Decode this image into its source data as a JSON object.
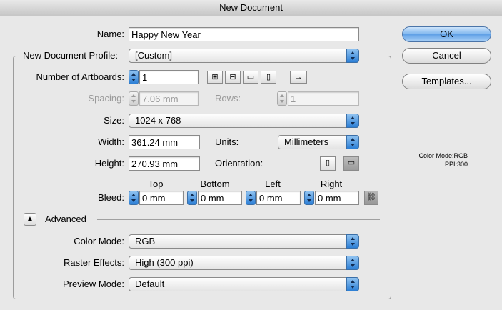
{
  "window": {
    "title": "New Document"
  },
  "name": {
    "label": "Name:",
    "value": "Happy New Year"
  },
  "profile": {
    "label": "New Document Profile:",
    "value": "[Custom]"
  },
  "artboards": {
    "label": "Number of Artboards:",
    "value": "1",
    "layout_icons": [
      "grid-by-row-icon",
      "grid-by-column-icon",
      "arrange-by-row-icon",
      "arrange-by-column-icon",
      "change-to-right-to-left-layout-icon"
    ]
  },
  "spacing": {
    "label": "Spacing:",
    "value": "7.06 mm",
    "rows_label": "Rows:",
    "rows_value": "1"
  },
  "size": {
    "label": "Size:",
    "value": "1024 x 768"
  },
  "width": {
    "label": "Width:",
    "value": "361.24 mm"
  },
  "units": {
    "label": "Units:",
    "value": "Millimeters"
  },
  "height": {
    "label": "Height:",
    "value": "270.93 mm"
  },
  "orientation": {
    "label": "Orientation:",
    "selected": "landscape"
  },
  "bleed": {
    "label": "Bleed:",
    "top_label": "Top",
    "top": "0 mm",
    "bottom_label": "Bottom",
    "bottom": "0 mm",
    "left_label": "Left",
    "left": "0 mm",
    "right_label": "Right",
    "right": "0 mm"
  },
  "advanced": {
    "label": "Advanced"
  },
  "color_mode": {
    "label": "Color Mode:",
    "value": "RGB"
  },
  "raster_effects": {
    "label": "Raster Effects:",
    "value": "High (300 ppi)"
  },
  "preview_mode": {
    "label": "Preview Mode:",
    "value": "Default"
  },
  "buttons": {
    "ok": "OK",
    "cancel": "Cancel",
    "templates": "Templates..."
  },
  "info": {
    "color_mode": "Color Mode:RGB",
    "ppi": "PPI:300"
  },
  "colors": {
    "accent": "#5f9fe6",
    "window_bg": "#e8e8e8"
  }
}
